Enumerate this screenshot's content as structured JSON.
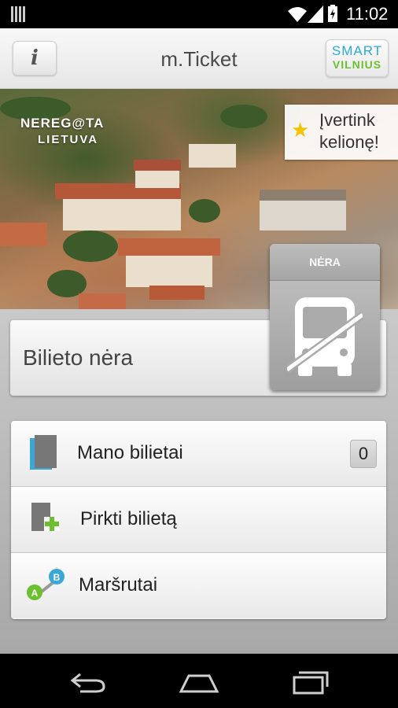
{
  "status_bar": {
    "time": "11:02"
  },
  "header": {
    "title": "m.Ticket",
    "info_label": "i",
    "logo_line1": "SMART",
    "logo_line2": "VILNIUS"
  },
  "banner": {
    "nereg_line1": "NEREG@TA",
    "nereg_line2": "LIETUVA",
    "rate_line1": "Įvertink",
    "rate_line2": "kelionę!"
  },
  "ticket": {
    "status_label": "Bilieto nėra",
    "badge_label": "NĖRA"
  },
  "menu": {
    "items": [
      {
        "label": "Mano bilietai",
        "icon": "tickets-icon",
        "count": "0"
      },
      {
        "label": "Pirkti bilietą",
        "icon": "buy-ticket-icon"
      },
      {
        "label": "Maršrutai",
        "icon": "route-icon"
      }
    ]
  },
  "colors": {
    "accent_blue": "#2aa9d6",
    "accent_green": "#6cbf2e",
    "panel_gray": "#b8b8b8"
  }
}
